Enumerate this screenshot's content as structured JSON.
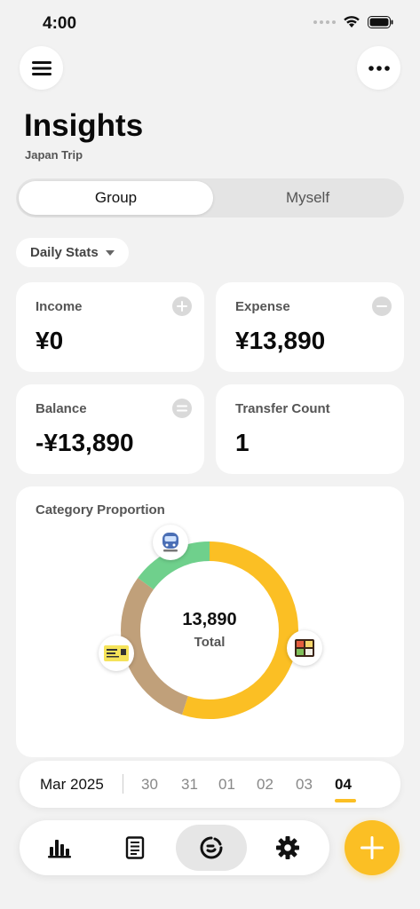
{
  "status_bar": {
    "time": "4:00"
  },
  "header": {
    "title": "Insights",
    "subtitle": "Japan Trip"
  },
  "segmented": {
    "options": [
      {
        "label": "Group",
        "selected": true
      },
      {
        "label": "Myself",
        "selected": false
      }
    ]
  },
  "stats_selector": {
    "label": "Daily Stats"
  },
  "cards": {
    "income": {
      "label": "Income",
      "value": "¥0"
    },
    "expense": {
      "label": "Expense",
      "value": "¥13,890"
    },
    "balance": {
      "label": "Balance",
      "value": "-¥13,890"
    },
    "transfer_count": {
      "label": "Transfer Count",
      "value": "1"
    }
  },
  "category": {
    "title": "Category Proportion",
    "total_value": "13,890",
    "total_label": "Total",
    "segments": [
      {
        "icon": "food-box-icon",
        "fraction": 0.55,
        "color": "#fbbf24"
      },
      {
        "icon": "ticket-icon",
        "fraction": 0.3,
        "color": "#c0a07a"
      },
      {
        "icon": "train-icon",
        "fraction": 0.15,
        "color": "#6fd08c"
      }
    ]
  },
  "date_bar": {
    "month": "Mar 2025",
    "days": [
      "30",
      "31",
      "01",
      "02",
      "03",
      "04"
    ],
    "active_day": "04"
  },
  "tab_bar": {
    "items": [
      "chart-icon",
      "receipt-icon",
      "insights-icon",
      "gear-icon"
    ],
    "active": "insights-icon"
  },
  "colors": {
    "accent": "#fbbf24",
    "background": "#f2f2f2",
    "card": "#ffffff"
  }
}
